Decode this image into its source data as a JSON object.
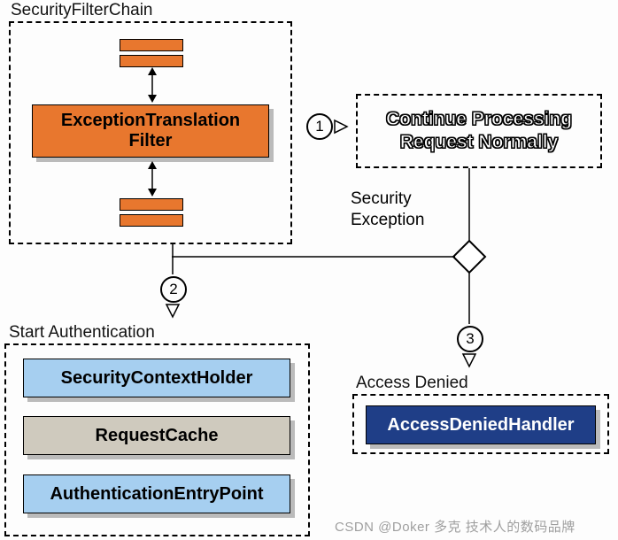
{
  "chain": {
    "title": "SecurityFilterChain",
    "filter": "ExceptionTranslation\nFilter"
  },
  "steps": {
    "one": "1",
    "two": "2",
    "three": "3"
  },
  "continue_box": "Continue Processing\nRequest Normally",
  "security_exception": "Security\nException",
  "auth": {
    "title": "Start Authentication",
    "ctx": "SecurityContextHolder",
    "cache": "RequestCache",
    "entry": "AuthenticationEntryPoint"
  },
  "denied": {
    "title": "Access Denied",
    "handler": "AccessDeniedHandler"
  },
  "watermark": "CSDN @Doker 多克 技术人的数码品牌"
}
